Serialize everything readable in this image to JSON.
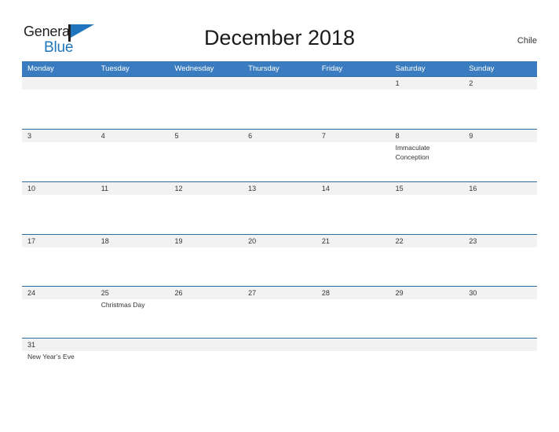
{
  "brand": {
    "name_part1": "General",
    "name_part2": "Blue",
    "flag_icon": "flag-triangle-icon",
    "color_dark": "#231f20",
    "color_blue": "#1f76bc"
  },
  "header": {
    "title": "December 2018",
    "country": "Chile"
  },
  "calendar": {
    "header_bg": "#3a7cbf",
    "row_border": "#2e6da4",
    "number_band_bg": "#f2f2f2",
    "weekdays": [
      "Monday",
      "Tuesday",
      "Wednesday",
      "Thursday",
      "Friday",
      "Saturday",
      "Sunday"
    ],
    "weeks": [
      {
        "days": [
          {
            "number": "",
            "event": ""
          },
          {
            "number": "",
            "event": ""
          },
          {
            "number": "",
            "event": ""
          },
          {
            "number": "",
            "event": ""
          },
          {
            "number": "",
            "event": ""
          },
          {
            "number": "1",
            "event": ""
          },
          {
            "number": "2",
            "event": ""
          }
        ]
      },
      {
        "days": [
          {
            "number": "3",
            "event": ""
          },
          {
            "number": "4",
            "event": ""
          },
          {
            "number": "5",
            "event": ""
          },
          {
            "number": "6",
            "event": ""
          },
          {
            "number": "7",
            "event": ""
          },
          {
            "number": "8",
            "event": "Immaculate Conception"
          },
          {
            "number": "9",
            "event": ""
          }
        ]
      },
      {
        "days": [
          {
            "number": "10",
            "event": ""
          },
          {
            "number": "11",
            "event": ""
          },
          {
            "number": "12",
            "event": ""
          },
          {
            "number": "13",
            "event": ""
          },
          {
            "number": "14",
            "event": ""
          },
          {
            "number": "15",
            "event": ""
          },
          {
            "number": "16",
            "event": ""
          }
        ]
      },
      {
        "days": [
          {
            "number": "17",
            "event": ""
          },
          {
            "number": "18",
            "event": ""
          },
          {
            "number": "19",
            "event": ""
          },
          {
            "number": "20",
            "event": ""
          },
          {
            "number": "21",
            "event": ""
          },
          {
            "number": "22",
            "event": ""
          },
          {
            "number": "23",
            "event": ""
          }
        ]
      },
      {
        "days": [
          {
            "number": "24",
            "event": ""
          },
          {
            "number": "25",
            "event": "Christmas Day"
          },
          {
            "number": "26",
            "event": ""
          },
          {
            "number": "27",
            "event": ""
          },
          {
            "number": "28",
            "event": ""
          },
          {
            "number": "29",
            "event": ""
          },
          {
            "number": "30",
            "event": ""
          }
        ]
      },
      {
        "days": [
          {
            "number": "31",
            "event": "New Year’s Eve"
          },
          {
            "number": "",
            "event": ""
          },
          {
            "number": "",
            "event": ""
          },
          {
            "number": "",
            "event": ""
          },
          {
            "number": "",
            "event": ""
          },
          {
            "number": "",
            "event": ""
          },
          {
            "number": "",
            "event": ""
          }
        ]
      }
    ]
  }
}
